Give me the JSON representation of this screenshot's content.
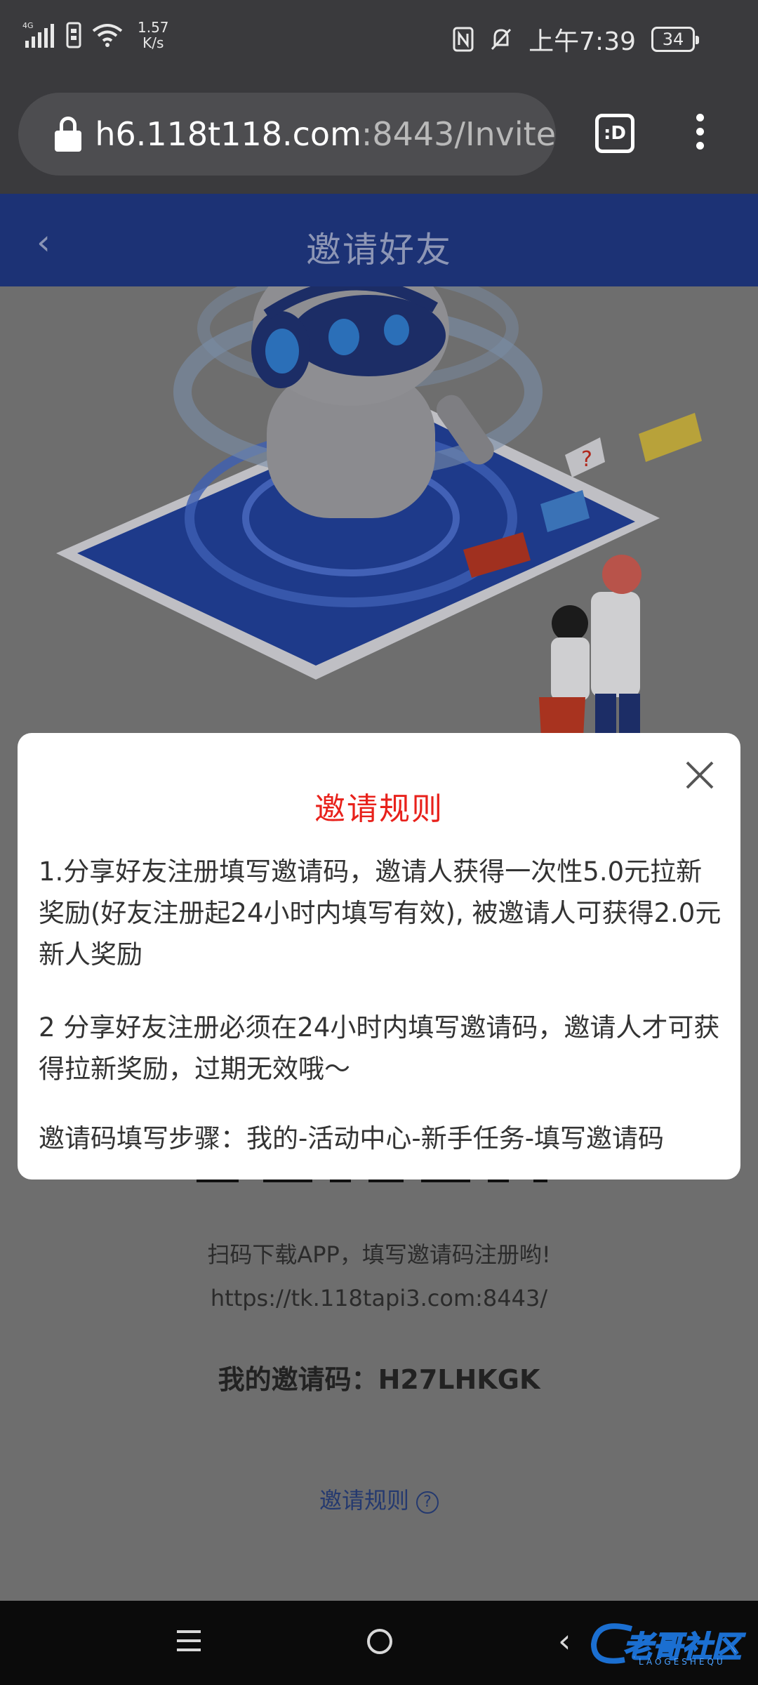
{
  "status_bar": {
    "network": "4G",
    "speed_value": "1.57",
    "speed_unit": "K/s",
    "time": "上午7:39",
    "battery": "34"
  },
  "browser": {
    "url_host": "h6.118t118.com",
    "url_rest": ":8443/Invite",
    "tab_icon_text": ":D"
  },
  "header": {
    "back_glyph": "‹",
    "title": "邀请好友"
  },
  "page": {
    "scan_text": "扫码下载APP，填写邀请码注册哟!",
    "download_url": "https://tk.118tapi3.com:8443/",
    "my_code_label": "我的邀请码：",
    "my_code_value": "H27LHKGK",
    "rules_link": "邀请规则",
    "rules_link_icon": "?"
  },
  "modal": {
    "title": "邀请规则",
    "rule1": "1.分享好友注册填写邀请码，邀请人获得一次性5.0元拉新奖励(好友注册起24小时内填写有效), 被邀请人可获得2.0元新人奖励",
    "rule2": "2 分享好友注册必须在24小时内填写邀请码，邀请人才可获得拉新奖励，过期无效哦～",
    "rule3": "邀请码填写步骤：我的-活动中心-新手任务-填写邀请码"
  },
  "nav": {
    "back_glyph": "‹"
  },
  "watermark": {
    "text": "老哥社区",
    "sub": "LAOGESHEQU"
  }
}
